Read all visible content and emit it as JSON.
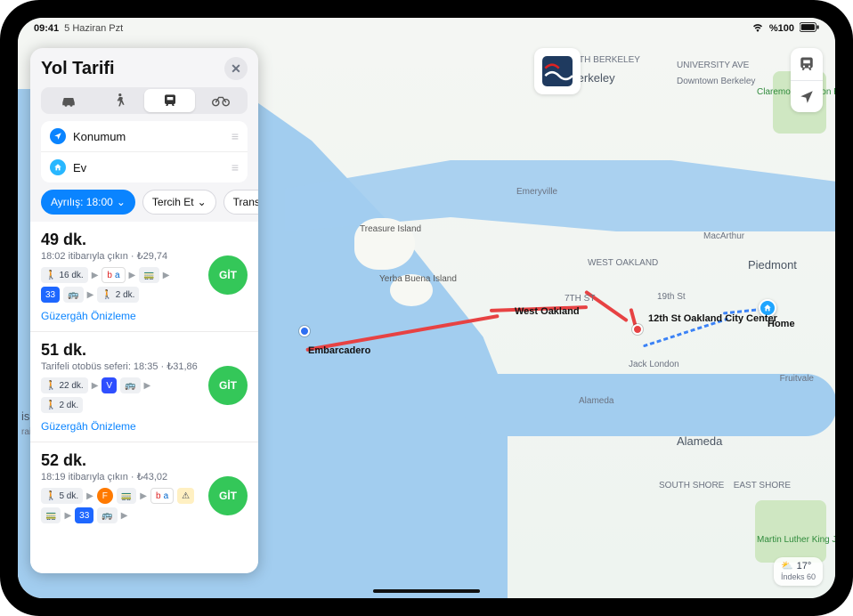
{
  "statusbar": {
    "time": "09:41",
    "date": "5 Haziran Pzt",
    "battery": "%100"
  },
  "panel": {
    "title": "Yol Tarifi",
    "from_label": "Konumum",
    "to_label": "Ev",
    "depart_label": "Ayrılış: 18:00",
    "prefer_label": "Tercih Et",
    "transit_card_label": "Transit Ca"
  },
  "routes": [
    {
      "duration": "49 dk.",
      "subtitle": "18:02 itibarıyla çıkın · ₺29,74",
      "preview": "Güzergâh Önizleme",
      "go": "GİT",
      "steps_a": {
        "walk1": "16 dk.",
        "bus": "33",
        "walk2": "2 dk."
      }
    },
    {
      "duration": "51 dk.",
      "subtitle": "Tarifeli otobüs seferi: 18:35 · ₺31,86",
      "preview": "Güzergâh Önizleme",
      "go": "GİT",
      "steps_b": {
        "walk1": "22 dk.",
        "bus": "V",
        "walk2": "2 dk."
      }
    },
    {
      "duration": "52 dk.",
      "subtitle": "18:19 itibarıyla çıkın · ₺43,02",
      "go": "GİT",
      "steps_c": {
        "walk1": "5 dk.",
        "line": "F",
        "bus": "33"
      }
    }
  ],
  "map": {
    "labels": {
      "berkeley": "Berkeley",
      "nberkeley": "NORTH BERKELEY",
      "downtownb": "Downtown Berkeley",
      "claremont": "Claremont Canyon Regi… Preserve",
      "emeryville": "Emeryville",
      "treasure": "Treasure Island",
      "yerba": "Yerba Buena Island",
      "woak": "WEST OAKLAND",
      "macarthur": "MacArthur",
      "piedmont": "Piedmont",
      "nineteenth": "19th St",
      "twelfth": "12th St Oakland City Center",
      "jack": "Jack London",
      "home": "Home",
      "alameda": "Alameda",
      "alameda2": "Alameda",
      "fruitvale": "Fruitvale",
      "southshore": "SOUTH SHORE",
      "eastshore": "EAST SHORE",
      "mlk": "Martin Luther King Jr. Regio…",
      "univ": "UNIVERSITY AVE",
      "seventh": "7TH ST",
      "embar": "Embarcadero",
      "westoak": "West Oakland",
      "isco": "isco",
      "rain": "rain"
    },
    "home_badge": "Home"
  },
  "weather": {
    "temp": "17°",
    "index": "İndeks 60"
  }
}
